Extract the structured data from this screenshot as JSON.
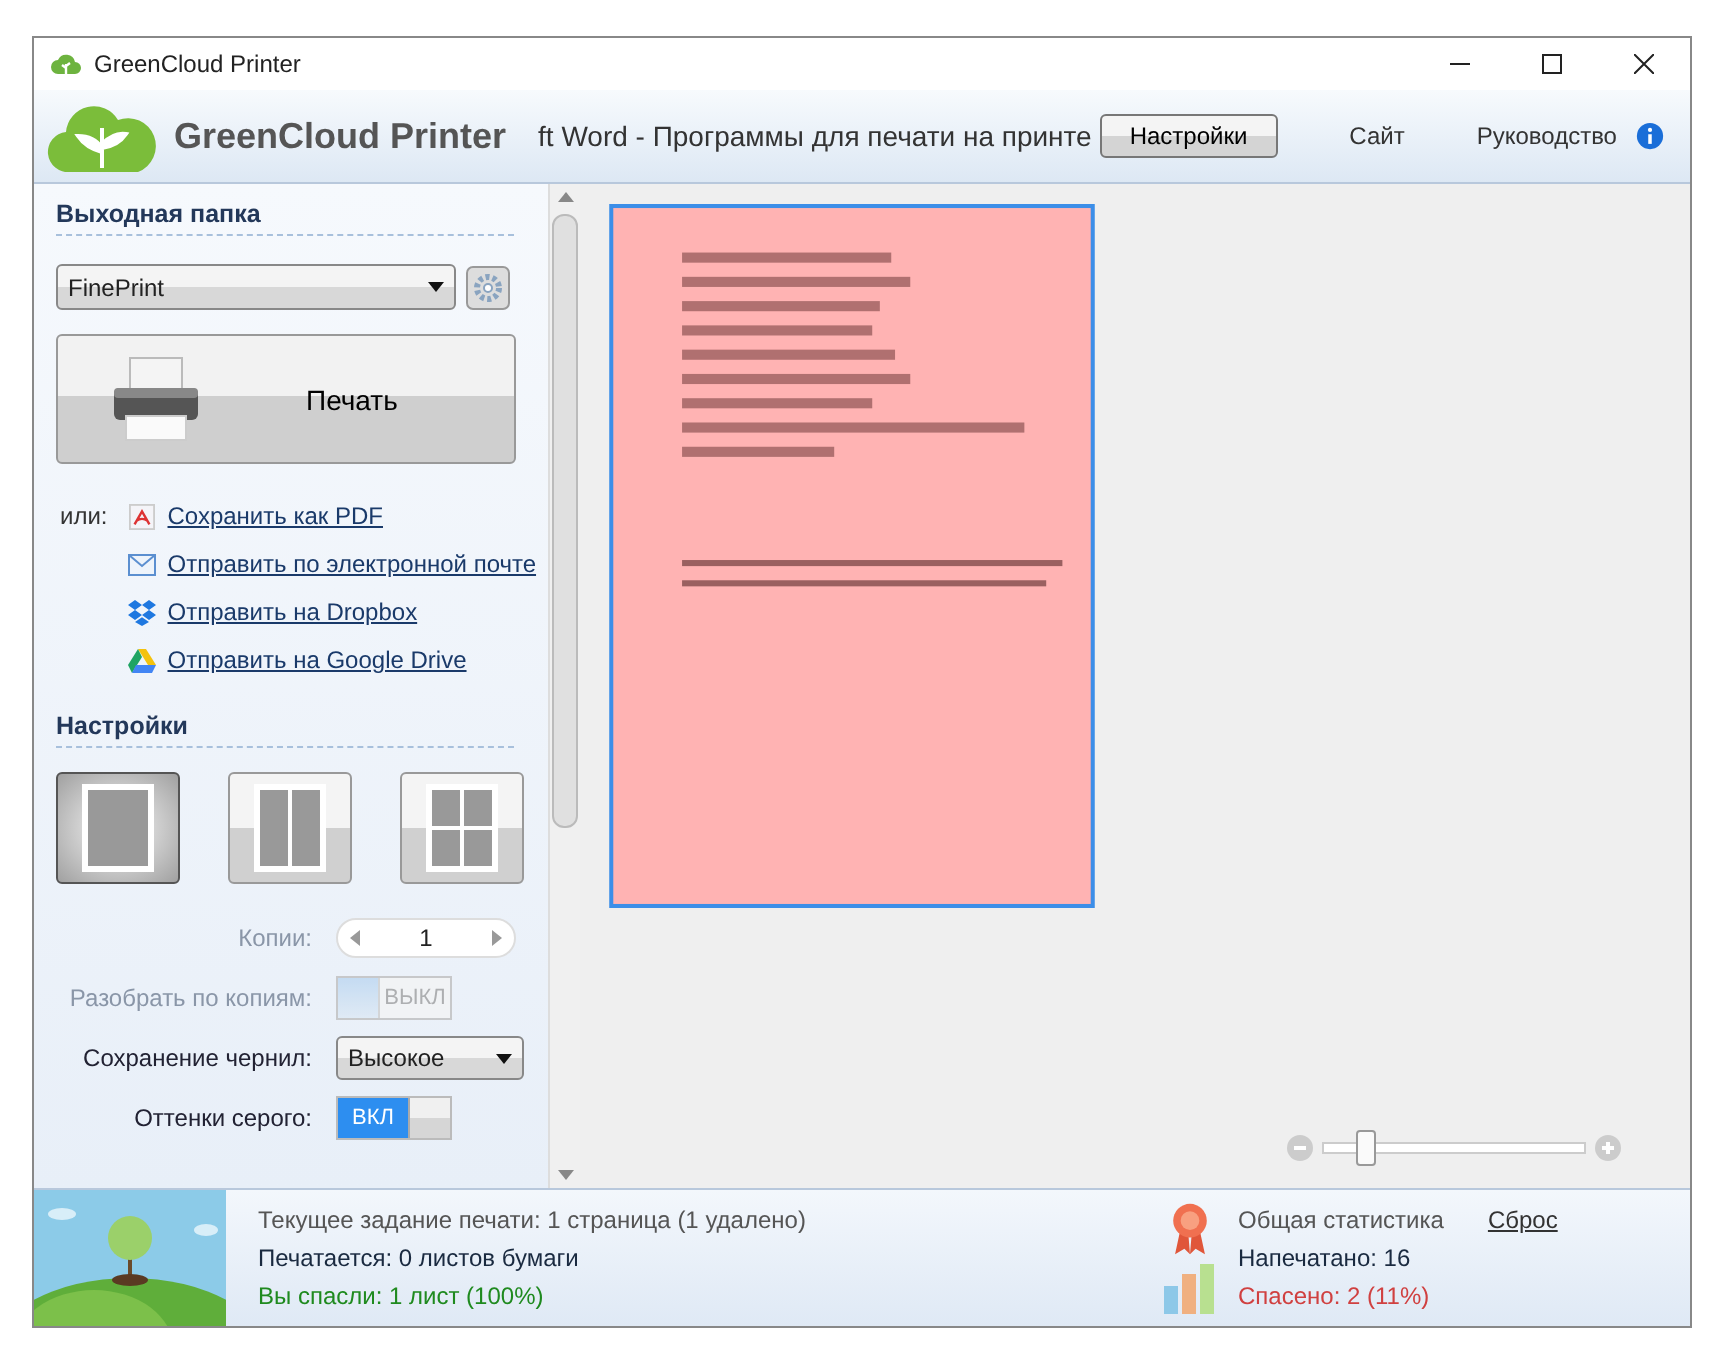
{
  "window": {
    "title": "GreenCloud Printer"
  },
  "header": {
    "app_name": "GreenCloud Printer",
    "document_title": "ft Word - Программы для печати на принте",
    "settings_button": "Настройки",
    "links": [
      "Сайт",
      "Руководство"
    ]
  },
  "output": {
    "heading": "Выходная папка",
    "printer": "FinePrint",
    "print_button": "Печать",
    "or_label": "или:",
    "actions": [
      {
        "kind": "pdf",
        "label": "Сохранить как PDF"
      },
      {
        "kind": "mail",
        "label": "Отправить по электронной почте"
      },
      {
        "kind": "dropbox",
        "label": "Отправить на Dropbox"
      },
      {
        "kind": "drive",
        "label": "Отправить на Google Drive"
      }
    ]
  },
  "settings": {
    "heading": "Настройки",
    "layouts": [
      {
        "kind": "one",
        "selected": true
      },
      {
        "kind": "two",
        "selected": false
      },
      {
        "kind": "four",
        "selected": false
      }
    ],
    "copies": {
      "label": "Копии:",
      "value": "1",
      "disabled": true
    },
    "collate": {
      "label": "Разобрать по копиям:",
      "on": false,
      "text": "ВЫКЛ",
      "disabled": true
    },
    "ink_saving": {
      "label": "Сохранение чернил:",
      "value": "Высокое"
    },
    "grayscale": {
      "label": "Оттенки серого:",
      "on": true,
      "text": "ВКЛ",
      "disabled": false
    }
  },
  "preview": {
    "zoom": {
      "level": 0.12
    }
  },
  "status": {
    "current_job": "Текущее задание печати: 1 страница (1 удалено)",
    "printing": "Печатается: 0 листов бумаги",
    "saved": "Вы спасли: 1 лист (100%)",
    "stats_title": "Общая статистика",
    "reset_link": "Сброс",
    "printed": "Напечатано: 16",
    "saved_total": "Спасено: 2 (11%)"
  }
}
